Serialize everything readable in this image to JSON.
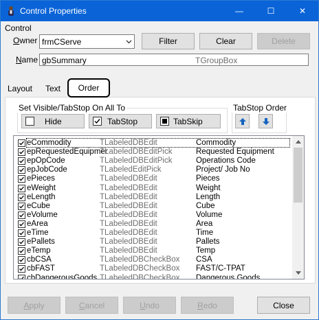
{
  "window": {
    "title": "Control Properties",
    "minimize_glyph": "—",
    "maximize_glyph": "☐",
    "close_glyph": "✕"
  },
  "control": {
    "group_label": "Control",
    "owner_label_a": "O",
    "owner_label_b": "wner",
    "owner_value": "frmCServe",
    "filter_label": "Filter",
    "clear_label": "Clear",
    "delete_label": "Delete",
    "name_label_a": "N",
    "name_label_b": "ame",
    "name_value": "gbSummary",
    "name_type": "TGroupBox"
  },
  "tabs": {
    "layout": "Layout",
    "text": "Text",
    "order": "Order"
  },
  "order": {
    "visible_group_title": "Set Visible/TabStop On All To",
    "hide_label": "Hide",
    "tabstop_label": "TabStop",
    "tabskip_label": "TabSkip",
    "tabstop_order_title": "TabStop Order",
    "up_glyph": "↑",
    "down_glyph": "↓"
  },
  "list": {
    "rows": [
      {
        "name": "eCommodity",
        "type": "TLabeledDBEdit",
        "caption": "Commodity"
      },
      {
        "name": "epRequestedEquipment",
        "type": "TLabeledDBEditPick",
        "caption": "Requested Equipment"
      },
      {
        "name": "epOpCode",
        "type": "TLabeledDBEditPick",
        "caption": "Operations Code"
      },
      {
        "name": "epJobCode",
        "type": "TLabeledEditPick",
        "caption": "Project/ Job No"
      },
      {
        "name": "ePieces",
        "type": "TLabeledDBEdit",
        "caption": "Pieces"
      },
      {
        "name": "eWeight",
        "type": "TLabeledDBEdit",
        "caption": "Weight"
      },
      {
        "name": "eLength",
        "type": "TLabeledDBEdit",
        "caption": "Length"
      },
      {
        "name": "eCube",
        "type": "TLabeledDBEdit",
        "caption": "Cube"
      },
      {
        "name": "eVolume",
        "type": "TLabeledDBEdit",
        "caption": "Volume"
      },
      {
        "name": "eArea",
        "type": "TLabeledDBEdit",
        "caption": "Area"
      },
      {
        "name": "eTime",
        "type": "TLabeledDBEdit",
        "caption": "Time"
      },
      {
        "name": "ePallets",
        "type": "TLabeledDBEdit",
        "caption": "Pallets"
      },
      {
        "name": "eTemp",
        "type": "TLabeledDBEdit",
        "caption": "Temp"
      },
      {
        "name": "cbCSA",
        "type": "TLabeledDBCheckBox",
        "caption": "CSA"
      },
      {
        "name": "cbFAST",
        "type": "TLabeledDBCheckBox",
        "caption": "FAST/C-TPAT"
      },
      {
        "name": "cbDangerousGoods",
        "type": "TLabeledDBCheckBox",
        "caption": "Dangerous Goods"
      }
    ],
    "check_glyph": "✓",
    "scroll_up_glyph": "▲",
    "scroll_down_glyph": "▼"
  },
  "buttons": {
    "apply_a": "A",
    "apply_b": "pply",
    "cancel_a": "C",
    "cancel_b": "ancel",
    "undo_a": "U",
    "undo_b": "ndo",
    "redo_a": "R",
    "redo_b": "edo",
    "close_label": "Close"
  },
  "colors": {
    "title_bar": "#0a64d8",
    "up_down_arrow": "#1565c0"
  }
}
